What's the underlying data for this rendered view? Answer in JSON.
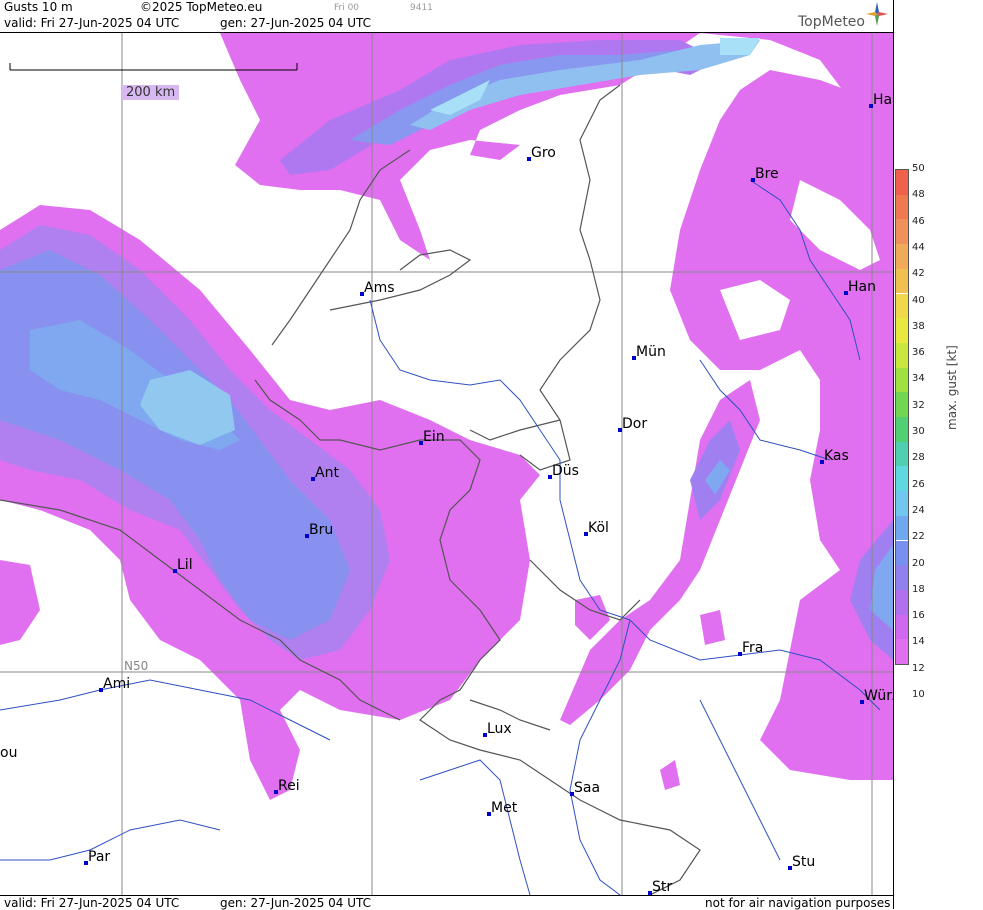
{
  "header": {
    "title": "Gusts 10 m",
    "copyright": "©2025 TopMeteo.eu",
    "fri": "Fri 00",
    "code": "9411",
    "valid": "valid:  Fri  27-Jun-2025  04 UTC",
    "gen": "gen:  27-Jun-2025 04 UTC",
    "logo": "TopMeteo"
  },
  "footer": {
    "valid": "valid:  Fri  27-Jun-2025  04 UTC",
    "gen": "gen:  27-Jun-2025 04 UTC",
    "note": "not for air navigation purposes"
  },
  "scale_bar": {
    "label": "200 km"
  },
  "grid": {
    "lat_label": "N50"
  },
  "cities": [
    {
      "name": "Gro"
    },
    {
      "name": "Ams"
    },
    {
      "name": "Ein"
    },
    {
      "name": "Ant"
    },
    {
      "name": "Bru"
    },
    {
      "name": "Lil"
    },
    {
      "name": "Ami"
    },
    {
      "name": "Rei"
    },
    {
      "name": "Par"
    },
    {
      "name": "Lux"
    },
    {
      "name": "Met"
    },
    {
      "name": "Saa"
    },
    {
      "name": "Str"
    },
    {
      "name": "Stu"
    },
    {
      "name": "Fra"
    },
    {
      "name": "Würz"
    },
    {
      "name": "Köl"
    },
    {
      "name": "Düs"
    },
    {
      "name": "Dor"
    },
    {
      "name": "Mün"
    },
    {
      "name": "Kas"
    },
    {
      "name": "Han"
    },
    {
      "name": "Bre"
    },
    {
      "name": "Ha"
    },
    {
      "name": "ou"
    }
  ],
  "legend": {
    "title": "max. gust [kt]",
    "ticks": [
      "50",
      "48",
      "46",
      "44",
      "42",
      "40",
      "38",
      "36",
      "34",
      "32",
      "30",
      "28",
      "26",
      "24",
      "22",
      "20",
      "18",
      "16",
      "14",
      "12",
      "10"
    ],
    "colors": [
      "#f0604a",
      "#f07a50",
      "#f0905a",
      "#f0aa5a",
      "#f0c050",
      "#f0d84a",
      "#e8e840",
      "#c8e840",
      "#a0e040",
      "#70d850",
      "#50d070",
      "#50d0b0",
      "#60d8e0",
      "#70c8f0",
      "#70a8f0",
      "#7890f0",
      "#9080f0",
      "#b070f0",
      "#d068f0",
      "#e070f0"
    ],
    "lines": {
      "ticks_color": "#555",
      "border": "#000"
    }
  },
  "map_colors": {
    "land": "#ffffff",
    "g12": "#e070f0",
    "g14": "#c878f0",
    "g16": "#a080f0",
    "g18": "#8090f0",
    "g20": "#80a8f0",
    "g22": "#90c8f0",
    "g24": "#a0e0f8",
    "border": "#555555",
    "river": "#3050c0",
    "grid": "#888888",
    "city": "#0000cc"
  }
}
